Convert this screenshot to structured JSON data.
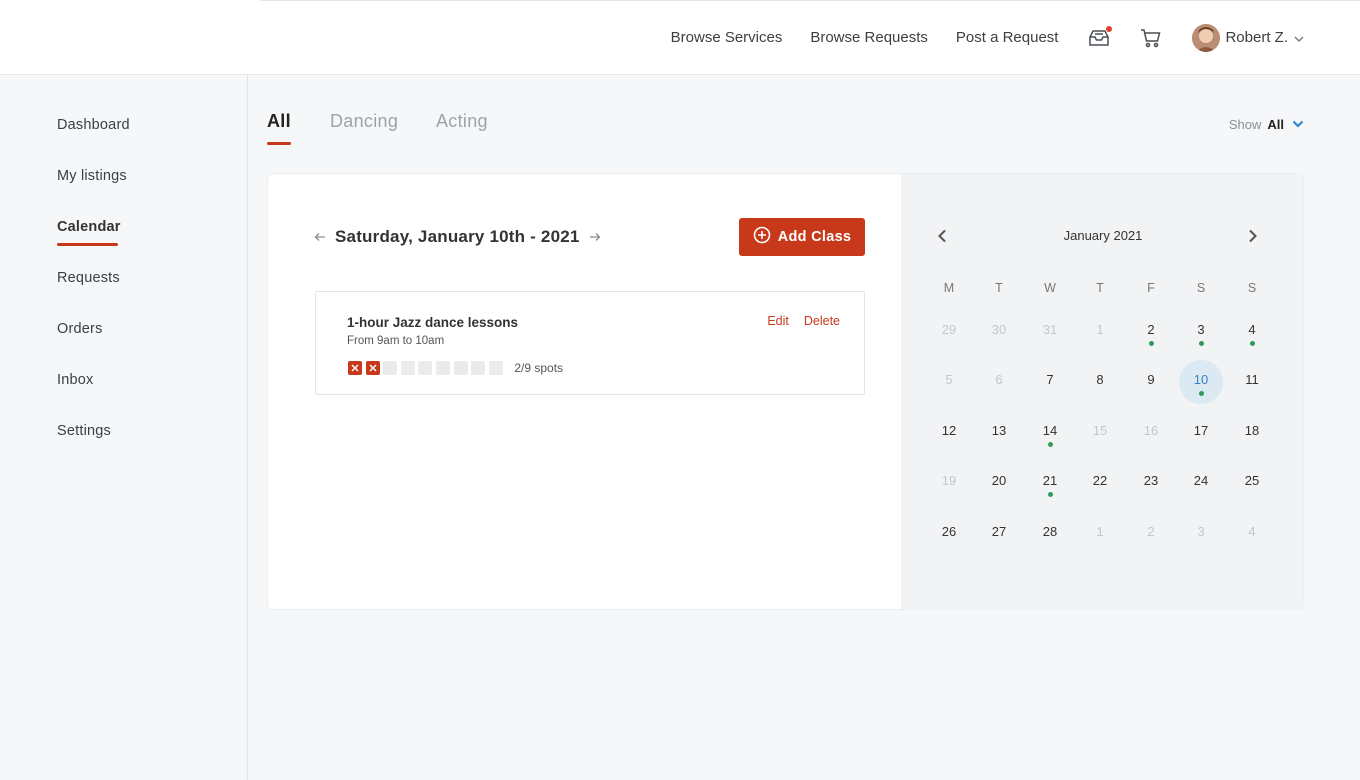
{
  "colors": {
    "accent": "#c8391c",
    "event_dot": "#2e9b5a",
    "selected_bg": "#dbe9f3",
    "selected_text": "#3b82c4",
    "link_blue": "#2f86d1"
  },
  "header": {
    "nav": [
      {
        "label": "Browse Services"
      },
      {
        "label": "Browse Requests"
      },
      {
        "label": "Post a Request"
      }
    ],
    "icons": [
      "inbox-tray-icon",
      "cart-icon"
    ],
    "user": {
      "name": "Robert Z.",
      "avatar": "avatar"
    }
  },
  "sidebar": {
    "items": [
      {
        "label": "Dashboard"
      },
      {
        "label": "My listings"
      },
      {
        "label": "Calendar",
        "active": true
      },
      {
        "label": "Requests"
      },
      {
        "label": "Orders"
      },
      {
        "label": "Inbox"
      },
      {
        "label": "Settings"
      }
    ]
  },
  "tabs": [
    {
      "label": "All",
      "active": true
    },
    {
      "label": "Dancing"
    },
    {
      "label": "Acting"
    }
  ],
  "filter": {
    "label": "Show",
    "value": "All"
  },
  "day_view": {
    "date": "Saturday, January 10th - 2021",
    "add_button": "Add Class",
    "classes": [
      {
        "title": "1-hour Jazz dance lessons",
        "time": "From 9am to 10am",
        "edit": "Edit",
        "delete": "Delete",
        "spots_taken": 2,
        "spots_total": 9,
        "spots_text": "2/9 spots"
      }
    ]
  },
  "calendar": {
    "month": "January 2021",
    "weekdays": [
      "M",
      "T",
      "W",
      "T",
      "F",
      "S",
      "S"
    ],
    "weeks": [
      [
        {
          "d": "29",
          "m": true
        },
        {
          "d": "30",
          "m": true
        },
        {
          "d": "31",
          "m": true
        },
        {
          "d": "1",
          "m": true
        },
        {
          "d": "2",
          "e": true
        },
        {
          "d": "3",
          "e": true
        },
        {
          "d": "4",
          "e": true
        }
      ],
      [
        {
          "d": "5",
          "m": true
        },
        {
          "d": "6",
          "m": true
        },
        {
          "d": "7"
        },
        {
          "d": "8"
        },
        {
          "d": "9"
        },
        {
          "d": "10",
          "e": true,
          "s": true
        },
        {
          "d": "11"
        }
      ],
      [
        {
          "d": "12"
        },
        {
          "d": "13"
        },
        {
          "d": "14",
          "e": true
        },
        {
          "d": "15",
          "m": true
        },
        {
          "d": "16",
          "m": true
        },
        {
          "d": "17"
        },
        {
          "d": "18"
        }
      ],
      [
        {
          "d": "19",
          "m": true
        },
        {
          "d": "20"
        },
        {
          "d": "21",
          "e": true
        },
        {
          "d": "22"
        },
        {
          "d": "23"
        },
        {
          "d": "24"
        },
        {
          "d": "25"
        }
      ],
      [
        {
          "d": "26"
        },
        {
          "d": "27"
        },
        {
          "d": "28"
        },
        {
          "d": "1",
          "m": true
        },
        {
          "d": "2",
          "m": true
        },
        {
          "d": "3",
          "m": true
        },
        {
          "d": "4",
          "m": true
        }
      ]
    ]
  }
}
